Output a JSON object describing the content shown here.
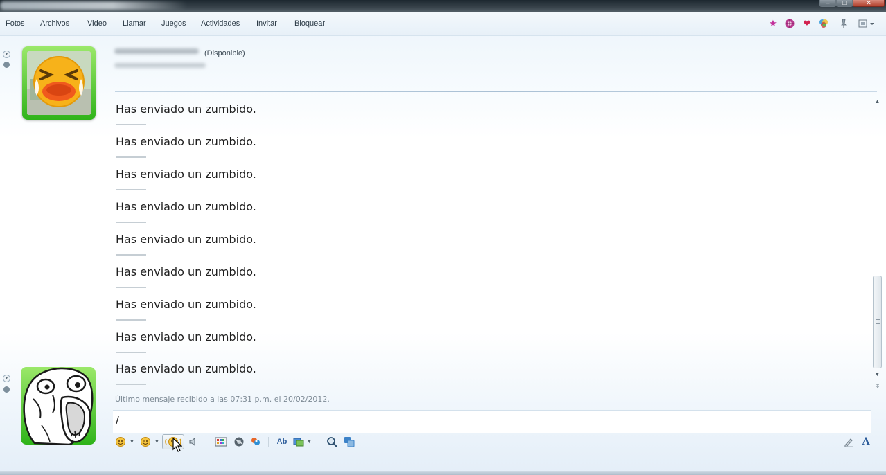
{
  "menu": {
    "items": [
      "Fotos",
      "Archivos",
      "Video",
      "Llamar",
      "Juegos",
      "Actividades",
      "Invitar",
      "Bloquear"
    ]
  },
  "toolbar_icons": [
    "star-icon",
    "globe-icon",
    "heart-icon",
    "flower-icon",
    "pin-icon",
    "layout-icon"
  ],
  "contact": {
    "status": "(Disponible)"
  },
  "messages": [
    "Has enviado un zumbido.",
    "Has enviado un zumbido.",
    "Has enviado un zumbido.",
    "Has enviado un zumbido.",
    "Has enviado un zumbido.",
    "Has enviado un zumbido.",
    "Has enviado un zumbido.",
    "Has enviado un zumbido.",
    "Has enviado un zumbido."
  ],
  "last_message_info": "Último mensaje recibido a las 07:31 p.m. el 20/02/2012.",
  "input": {
    "value": "/"
  },
  "bottom_toolbar_icons": [
    "emoticon-icon",
    "wink-icon",
    "nudge-icon",
    "voice-clip-icon",
    "gallery-icon",
    "games-icon",
    "activity-icon",
    "font-size-icon",
    "background-icon",
    "search-icon",
    "translate-icon",
    "handwriting-icon",
    "font-icon"
  ],
  "colors": {
    "accent_green": "#2fb31a",
    "window_top": "#1d2830",
    "message_text": "#1f1f1f",
    "info_text": "#7d8a95"
  }
}
